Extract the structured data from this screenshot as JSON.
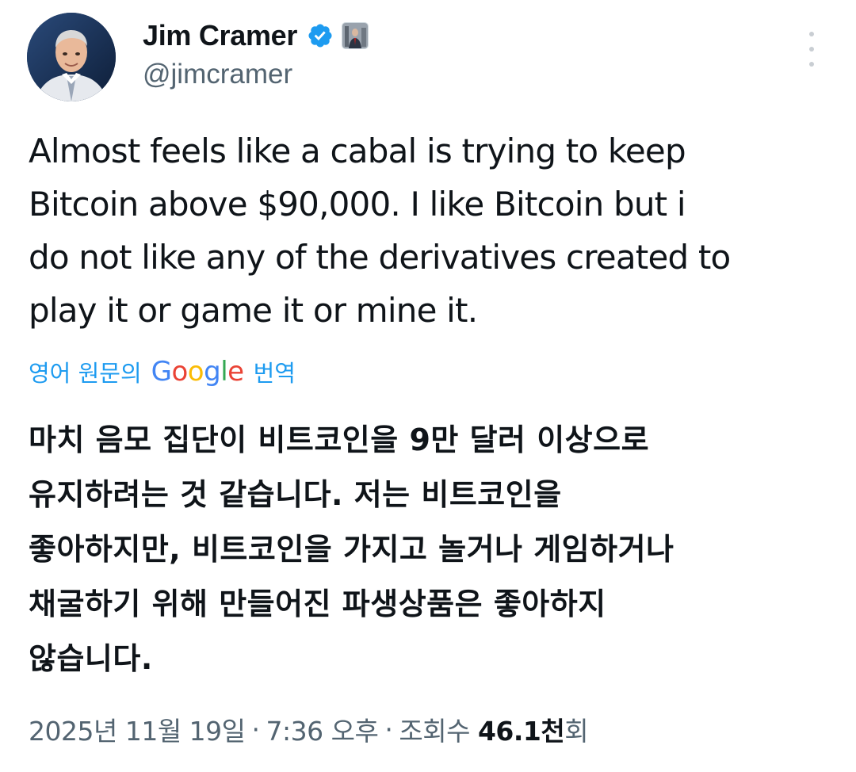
{
  "author": {
    "display_name": "Jim Cramer",
    "handle": "@jimcramer",
    "verified": true,
    "accent_color": "#1d9bf0"
  },
  "tweet": {
    "text": "Almost feels like a cabal is trying to keep\nBitcoin above $90,000. I like Bitcoin but i\ndo not like any of the derivatives created to\nplay it or game it or mine it.",
    "translation_prefix": "영어 원문의",
    "translation_brand": [
      "G",
      "o",
      "o",
      "g",
      "l",
      "e"
    ],
    "translation_suffix": "번역",
    "translated_text": "마치 음모 집단이 비트코인을 9만 달러 이상으로\n유지하려는 것 같습니다. 저는 비트코인을\n좋아하지만, 비트코인을 가지고 놀거나 게임하거나\n채굴하기 위해 만들어진 파생상품은 좋아하지\n않습니다."
  },
  "meta": {
    "date": "2025년 11월 19일",
    "time": "7:36 오후",
    "separator": "·",
    "views_count": "46.1천",
    "views_label": "회"
  },
  "icons": {
    "verified": "verified-badge-icon",
    "more": "more-options-icon",
    "affiliation": "affiliation-badge-icon"
  }
}
